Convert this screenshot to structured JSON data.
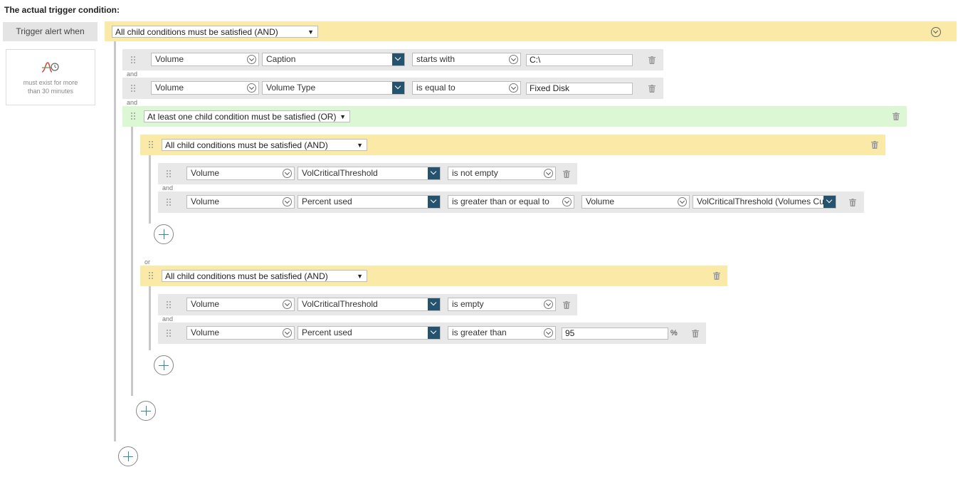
{
  "header": {
    "title": "The actual trigger condition:"
  },
  "trigger": {
    "label": "Trigger alert when"
  },
  "side": {
    "duration_text_1": "must exist for more",
    "duration_text_2": "than 30 minutes"
  },
  "root": {
    "logic": "All child conditions must be satisfied (AND)"
  },
  "conditions": {
    "c1": {
      "entity": "Volume",
      "field": "Caption",
      "operator": "starts with",
      "value": "C:\\"
    },
    "c2": {
      "entity": "Volume",
      "field": "Volume Type",
      "operator": "is equal to",
      "value": "Fixed Disk"
    }
  },
  "or_group": {
    "logic": "At least one child condition must be satisfied (OR)"
  },
  "and_group_1": {
    "logic": "All child conditions must be satisfied (AND)",
    "c1": {
      "entity": "Volume",
      "field": "VolCriticalThreshold",
      "operator": "is not empty"
    },
    "c2": {
      "entity": "Volume",
      "field": "Percent used",
      "operator": "is greater than or equal to",
      "entity2": "Volume",
      "field2": "VolCriticalThreshold (Volumes Cu"
    }
  },
  "and_group_2": {
    "logic": "All child conditions must be satisfied (AND)",
    "c1": {
      "entity": "Volume",
      "field": "VolCriticalThreshold",
      "operator": "is empty"
    },
    "c2": {
      "entity": "Volume",
      "field": "Percent used",
      "operator": "is greater than",
      "value": "95",
      "unit": "%"
    }
  },
  "joiners": {
    "and": "and",
    "or": "or"
  },
  "icons": {
    "grip": "drag-handle-icon",
    "trash": "trash-icon",
    "add": "add-circle-icon",
    "collapse": "chevron-down-icon",
    "duration": "time-chart-icon"
  },
  "colors": {
    "and_group": "#fbe9a8",
    "or_group": "#dcf7d4",
    "accent": "#25536d",
    "add": "#2c8ca0"
  }
}
